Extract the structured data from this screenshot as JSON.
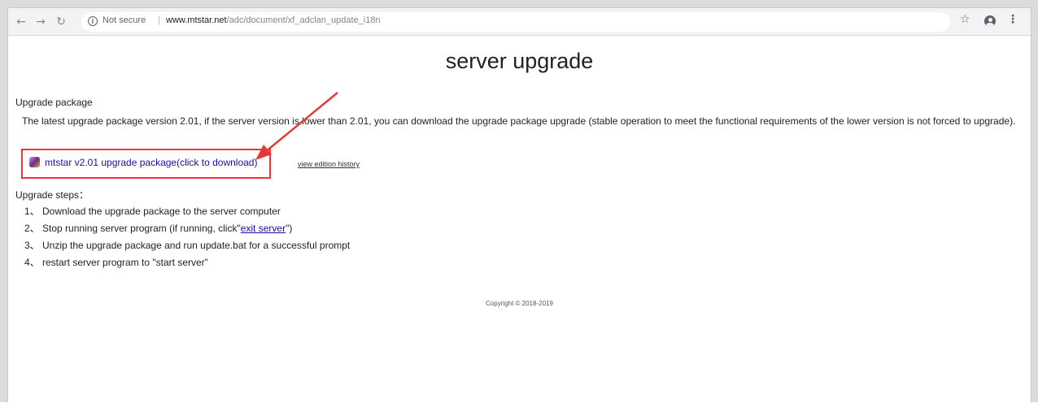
{
  "browser": {
    "back_icon": "arrow-left-icon",
    "forward_icon": "arrow-right-icon",
    "reload_icon": "reload-icon",
    "security_icon": "info-icon",
    "security_label": "Not secure",
    "url_host": "www.mtstar.net",
    "url_path": "/adc/document/xf_adclan_update_i18n",
    "bookmark_icon": "star-icon",
    "profile_icon": "account-icon",
    "menu_icon": "kebab-menu-icon"
  },
  "page": {
    "title": "server upgrade",
    "section_heading": "Upgrade package",
    "description": "The latest upgrade package version 2.01, if the server version is lower than 2.01, you can download the upgrade package upgrade (stable operation to meet the functional requirements of the lower version is not forced to upgrade).",
    "download_link": "mtstar v2.01 upgrade package(click to download)",
    "history_link": "view edition history",
    "steps_heading": "Upgrade steps：",
    "steps": [
      {
        "prefix": "1、 Download the upgrade package to the server computer",
        "link": "",
        "suffix": ""
      },
      {
        "prefix": "2、 Stop running server program (if running, click\"",
        "link": "exit server",
        "suffix": "\")"
      },
      {
        "prefix": "3、 Unzip the upgrade package and run update.bat for a successful prompt",
        "link": "",
        "suffix": ""
      },
      {
        "prefix": "4、  restart server program to \"start server\"",
        "link": "",
        "suffix": ""
      }
    ],
    "copyright": "Copyright © 2018-2019"
  },
  "colors": {
    "link": "#1a0dab",
    "annotation": "#e53935"
  }
}
